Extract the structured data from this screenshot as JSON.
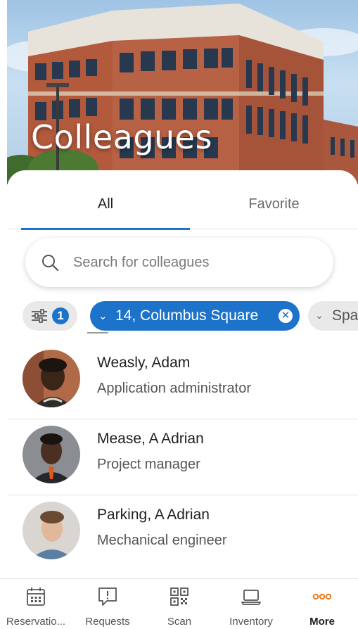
{
  "header": {
    "title": "Colleagues"
  },
  "tabs": [
    {
      "label": "All",
      "active": true
    },
    {
      "label": "Favorite",
      "active": false
    }
  ],
  "search": {
    "placeholder": "Search for colleagues",
    "value": ""
  },
  "filters": {
    "count": "1",
    "location": "14, Columbus Square",
    "space_partial": "Spa"
  },
  "colleagues": [
    {
      "name": "Weasly, Adam",
      "role": "Application administrator"
    },
    {
      "name": "Mease, A Adrian",
      "role": "Project manager"
    },
    {
      "name": "Parking, A Adrian",
      "role": "Mechanical engineer"
    }
  ],
  "bottom_nav": [
    {
      "label": "Reservatio...",
      "icon": "calendar-icon"
    },
    {
      "label": "Requests",
      "icon": "alert-chat-icon"
    },
    {
      "label": "Scan",
      "icon": "qr-code-icon"
    },
    {
      "label": "Inventory",
      "icon": "laptop-icon"
    },
    {
      "label": "More",
      "icon": "more-dots-icon",
      "active": true
    }
  ],
  "colors": {
    "accent": "#1d73c9",
    "more_orange": "#f07a1a"
  }
}
